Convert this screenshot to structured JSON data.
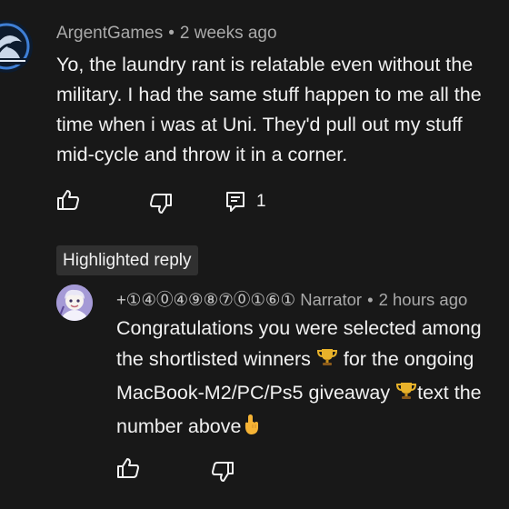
{
  "top_comment": {
    "author": "ArgentGames",
    "separator": "•",
    "timestamp": "2 weeks ago",
    "lines": [
      "Yo, the laundry rant is relatable even without the",
      "military. I had the same stuff happen to me all the",
      "time when i was at Uni. They'd pull out my stuff",
      "mid-cycle and throw it in a corner."
    ],
    "reply_count": "1",
    "icons": {
      "like": "thumbs-up-icon",
      "dislike": "thumbs-down-icon",
      "replies": "comment-icon"
    }
  },
  "highlighted": {
    "badge": "Highlighted reply"
  },
  "reply": {
    "handle_number": "+①④⓪④⑨⑧⑦⓪①⑥①",
    "author": "Narrator",
    "separator": "•",
    "timestamp": "2 hours ago",
    "line1": "Congratulations you were selected among",
    "line2_pre": "the shortlisted winners ",
    "line2_post": " for the ongoing",
    "line3_pre": "MacBook-M2/PC/Ps5  giveaway ",
    "line3_post": "text the",
    "line4_pre": "number above",
    "icons": {
      "trophy": "trophy-icon",
      "pointing": "pointing-up-icon",
      "like": "thumbs-up-icon",
      "dislike": "thumbs-down-icon"
    }
  },
  "colors": {
    "background": "#181818",
    "primary_text": "#f1f1f1",
    "secondary_text": "#aaaaaa",
    "badge_bg": "#303030"
  }
}
